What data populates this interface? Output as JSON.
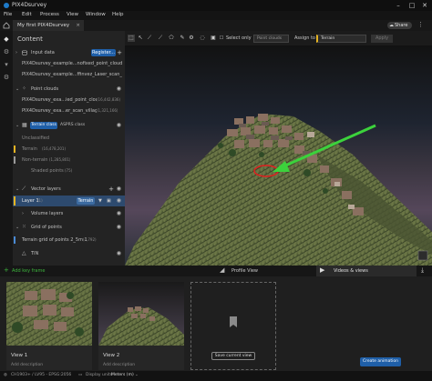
{
  "window": {
    "title": "PIX4Dsurvey",
    "minimize": "–",
    "maximize": "□",
    "close": "✕"
  },
  "menu": [
    "File",
    "Edit",
    "Process",
    "View",
    "Window",
    "Help"
  ],
  "tab": {
    "label": "My first PIX4Dsurvey project*",
    "close": "×"
  },
  "share": {
    "label": "Share"
  },
  "panel": {
    "title": "Content",
    "input_data": {
      "label": "Input data",
      "register": "Register..."
    },
    "files": [
      "PIX4Dsurvey_example...nofixed_point_cloud",
      "PIX4Dsurvey_example...ffinvez_Laser_scan_village"
    ],
    "point_clouds": {
      "label": "Point clouds"
    },
    "pc_items": [
      {
        "name": "PIX4Dsurvey_exa...ied_point_cloud",
        "count": "(16,442,836)"
      },
      {
        "name": "PIX4Dsurvey_exa...er_scan_village",
        "count": "(1,321,166)"
      }
    ],
    "class_tabs": {
      "terrain": "Terrain class",
      "asprs": "ASPRS class"
    },
    "classes": [
      {
        "name": "Unclassified",
        "count": ""
      },
      {
        "name": "Terrain",
        "count": "(16,478,201)"
      },
      {
        "name": "Non-terrain",
        "count": "(1,285,801)"
      },
      {
        "name": "Shaded points",
        "count": "(75)"
      }
    ],
    "vector_layers": {
      "label": "Vector layers"
    },
    "layer1": {
      "name": "Layer 1",
      "count": "(1)",
      "tag": "Terrain"
    },
    "volume_layers": {
      "label": "Volume layers"
    },
    "grid_of_points": {
      "label": "Grid of points"
    },
    "grid_item": {
      "name": "Terrain grid of points 2_5m 1",
      "count": "(4,792)"
    },
    "tin": {
      "label": "TIN"
    }
  },
  "toolbar": {
    "select_only": "Select only",
    "point_clouds_placeholder": "Point clouds",
    "assign_to": "Assign to",
    "terrain": "Terrain",
    "apply": "Apply"
  },
  "bottom": {
    "add_keyframe": "Add key frame",
    "profile_view": "Profile View",
    "videos_views": "Videos & views",
    "cards": [
      {
        "name": "View 1",
        "desc": "Add description"
      },
      {
        "name": "View 2",
        "desc": "Add description"
      }
    ],
    "save_current_view": "Save current view",
    "create_animation": "Create animation"
  },
  "status": {
    "crs": "CH1903+ / LV95 - EPSG:2056",
    "display_units_label": "Display units",
    "units": "Meters (m)"
  },
  "colors": {
    "accent": "#1f5fa8",
    "terrain": "#e6b422",
    "non_terrain": "#9a9a9a",
    "layer_select": "#2d4a6e",
    "arrow": "#3cd23c"
  }
}
